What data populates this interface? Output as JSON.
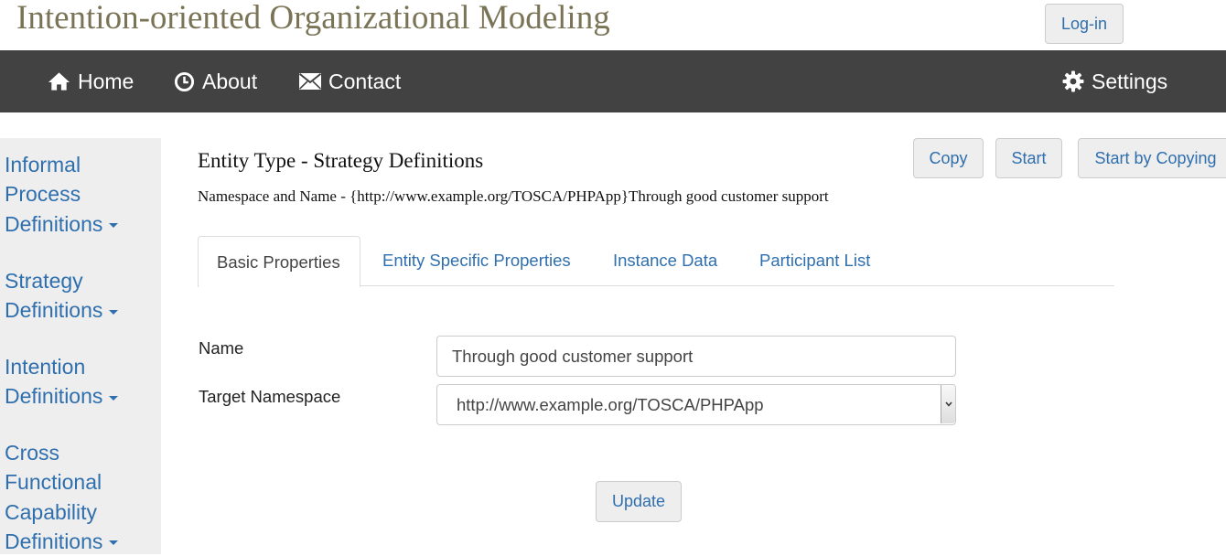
{
  "app": {
    "title": "Intention-oriented Organizational Modeling",
    "login_label": "Log-in"
  },
  "navbar": {
    "home": "Home",
    "about": "About",
    "contact": "Contact",
    "settings": "Settings"
  },
  "sidebar": {
    "groups": [
      {
        "lines": [
          "Informal",
          "Process",
          "Definitions"
        ]
      },
      {
        "lines": [
          "Strategy",
          "Definitions"
        ]
      },
      {
        "lines": [
          "Intention",
          "Definitions"
        ]
      },
      {
        "lines": [
          "Cross",
          "Functional",
          "Capability",
          "Definitions"
        ]
      }
    ]
  },
  "main": {
    "title": "Entity Type - Strategy Definitions",
    "namespace_line": "Namespace and Name - {http://www.example.org/TOSCA/PHPApp}Through good customer support",
    "actions": {
      "copy": "Copy",
      "start": "Start",
      "start_by_copying": "Start by Copying"
    },
    "tabs": [
      {
        "label": "Basic Properties",
        "active": true
      },
      {
        "label": "Entity Specific Properties",
        "active": false
      },
      {
        "label": "Instance Data",
        "active": false
      },
      {
        "label": "Participant List",
        "active": false
      }
    ],
    "form": {
      "name_label": "Name",
      "name_value": "Through good customer support",
      "target_namespace_label": "Target Namespace",
      "target_namespace_value": "http://www.example.org/TOSCA/PHPApp",
      "update_label": "Update"
    }
  },
  "colors": {
    "title": "#7a7456",
    "navbar": "#424242",
    "link": "#2f6fae",
    "sidebar_bg": "#eeeeee"
  },
  "icons": [
    "home-icon",
    "clock-icon",
    "envelope-icon",
    "gear-icon",
    "chevron-down-icon"
  ]
}
